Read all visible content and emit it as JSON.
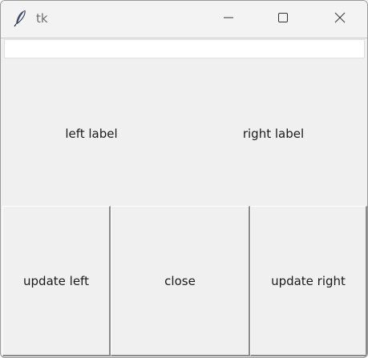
{
  "window": {
    "title": "tk"
  },
  "entry": {
    "value": ""
  },
  "labels": {
    "left": "left label",
    "right": "right label"
  },
  "buttons": {
    "update_left": "update left",
    "close": "close",
    "update_right": "update right"
  },
  "icons": {
    "app": "feather-icon",
    "minimize": "minimize-icon",
    "maximize": "maximize-icon",
    "close": "close-icon"
  }
}
